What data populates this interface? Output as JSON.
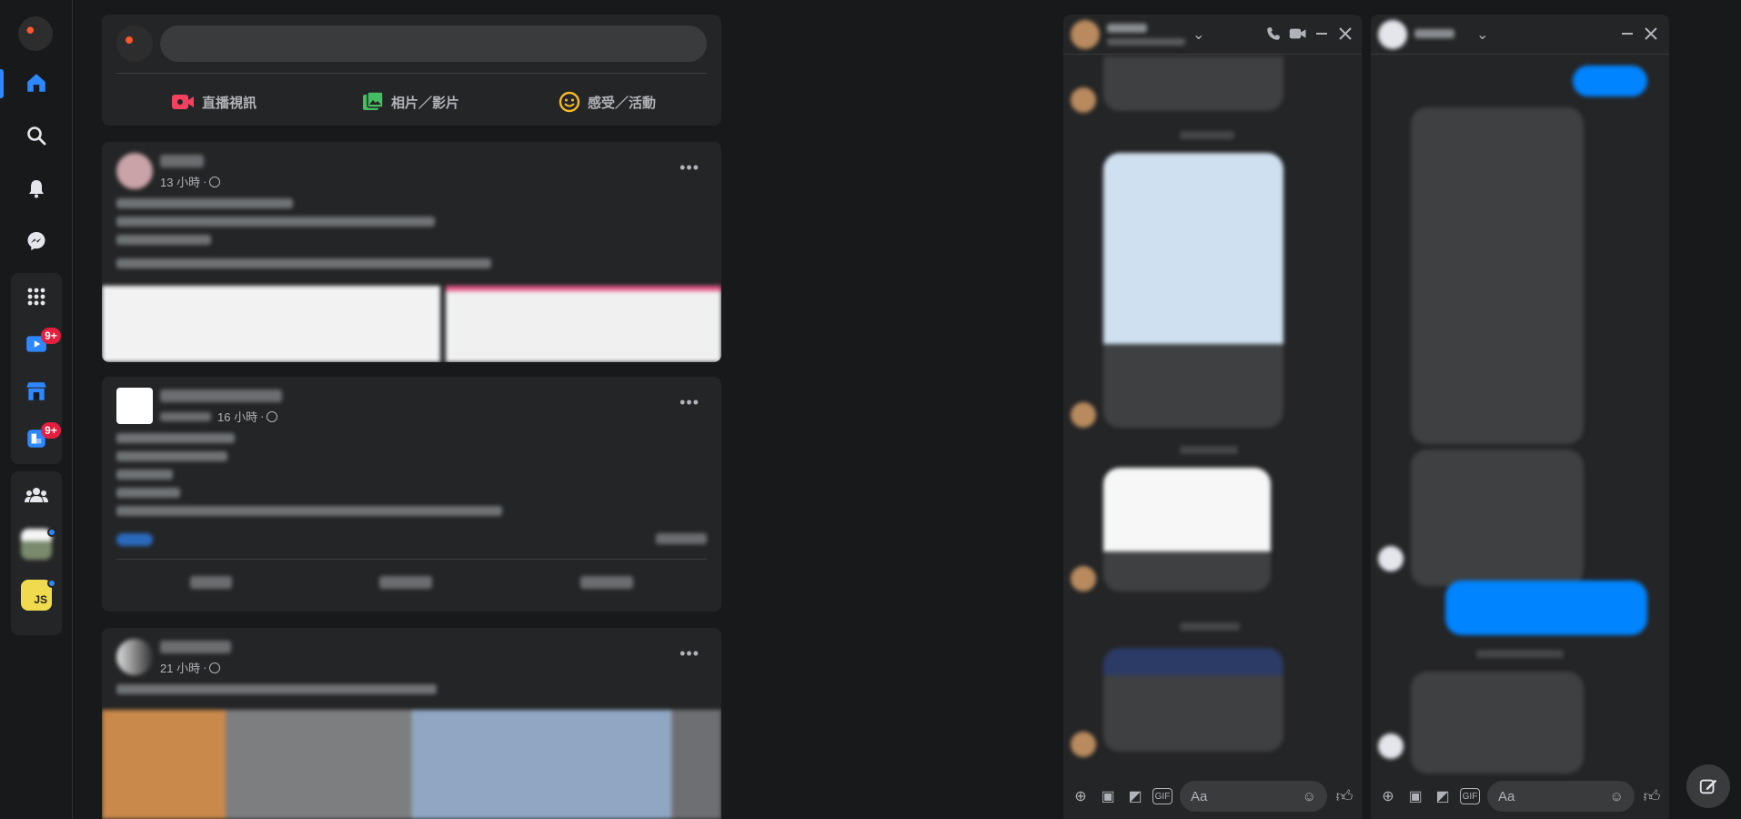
{
  "left_rail": {
    "badges": {
      "watch": "9+",
      "pages": "9+"
    },
    "shortcut_js": "JS"
  },
  "composer": {
    "live_label": "直播視訊",
    "photo_label": "相片／影片",
    "feeling_label": "感受／活動"
  },
  "posts": [
    {
      "time": "13 小時",
      "sep": " · "
    },
    {
      "time": "16 小時",
      "sep": " · "
    },
    {
      "time": "21 小時",
      "sep": " · "
    }
  ],
  "chats": [
    {
      "input_placeholder": "Aa"
    },
    {
      "input_placeholder": "Aa"
    }
  ],
  "colors": {
    "accent": "#2d88ff",
    "badge": "#e41e3f",
    "messenger_blue": "#0084ff"
  }
}
